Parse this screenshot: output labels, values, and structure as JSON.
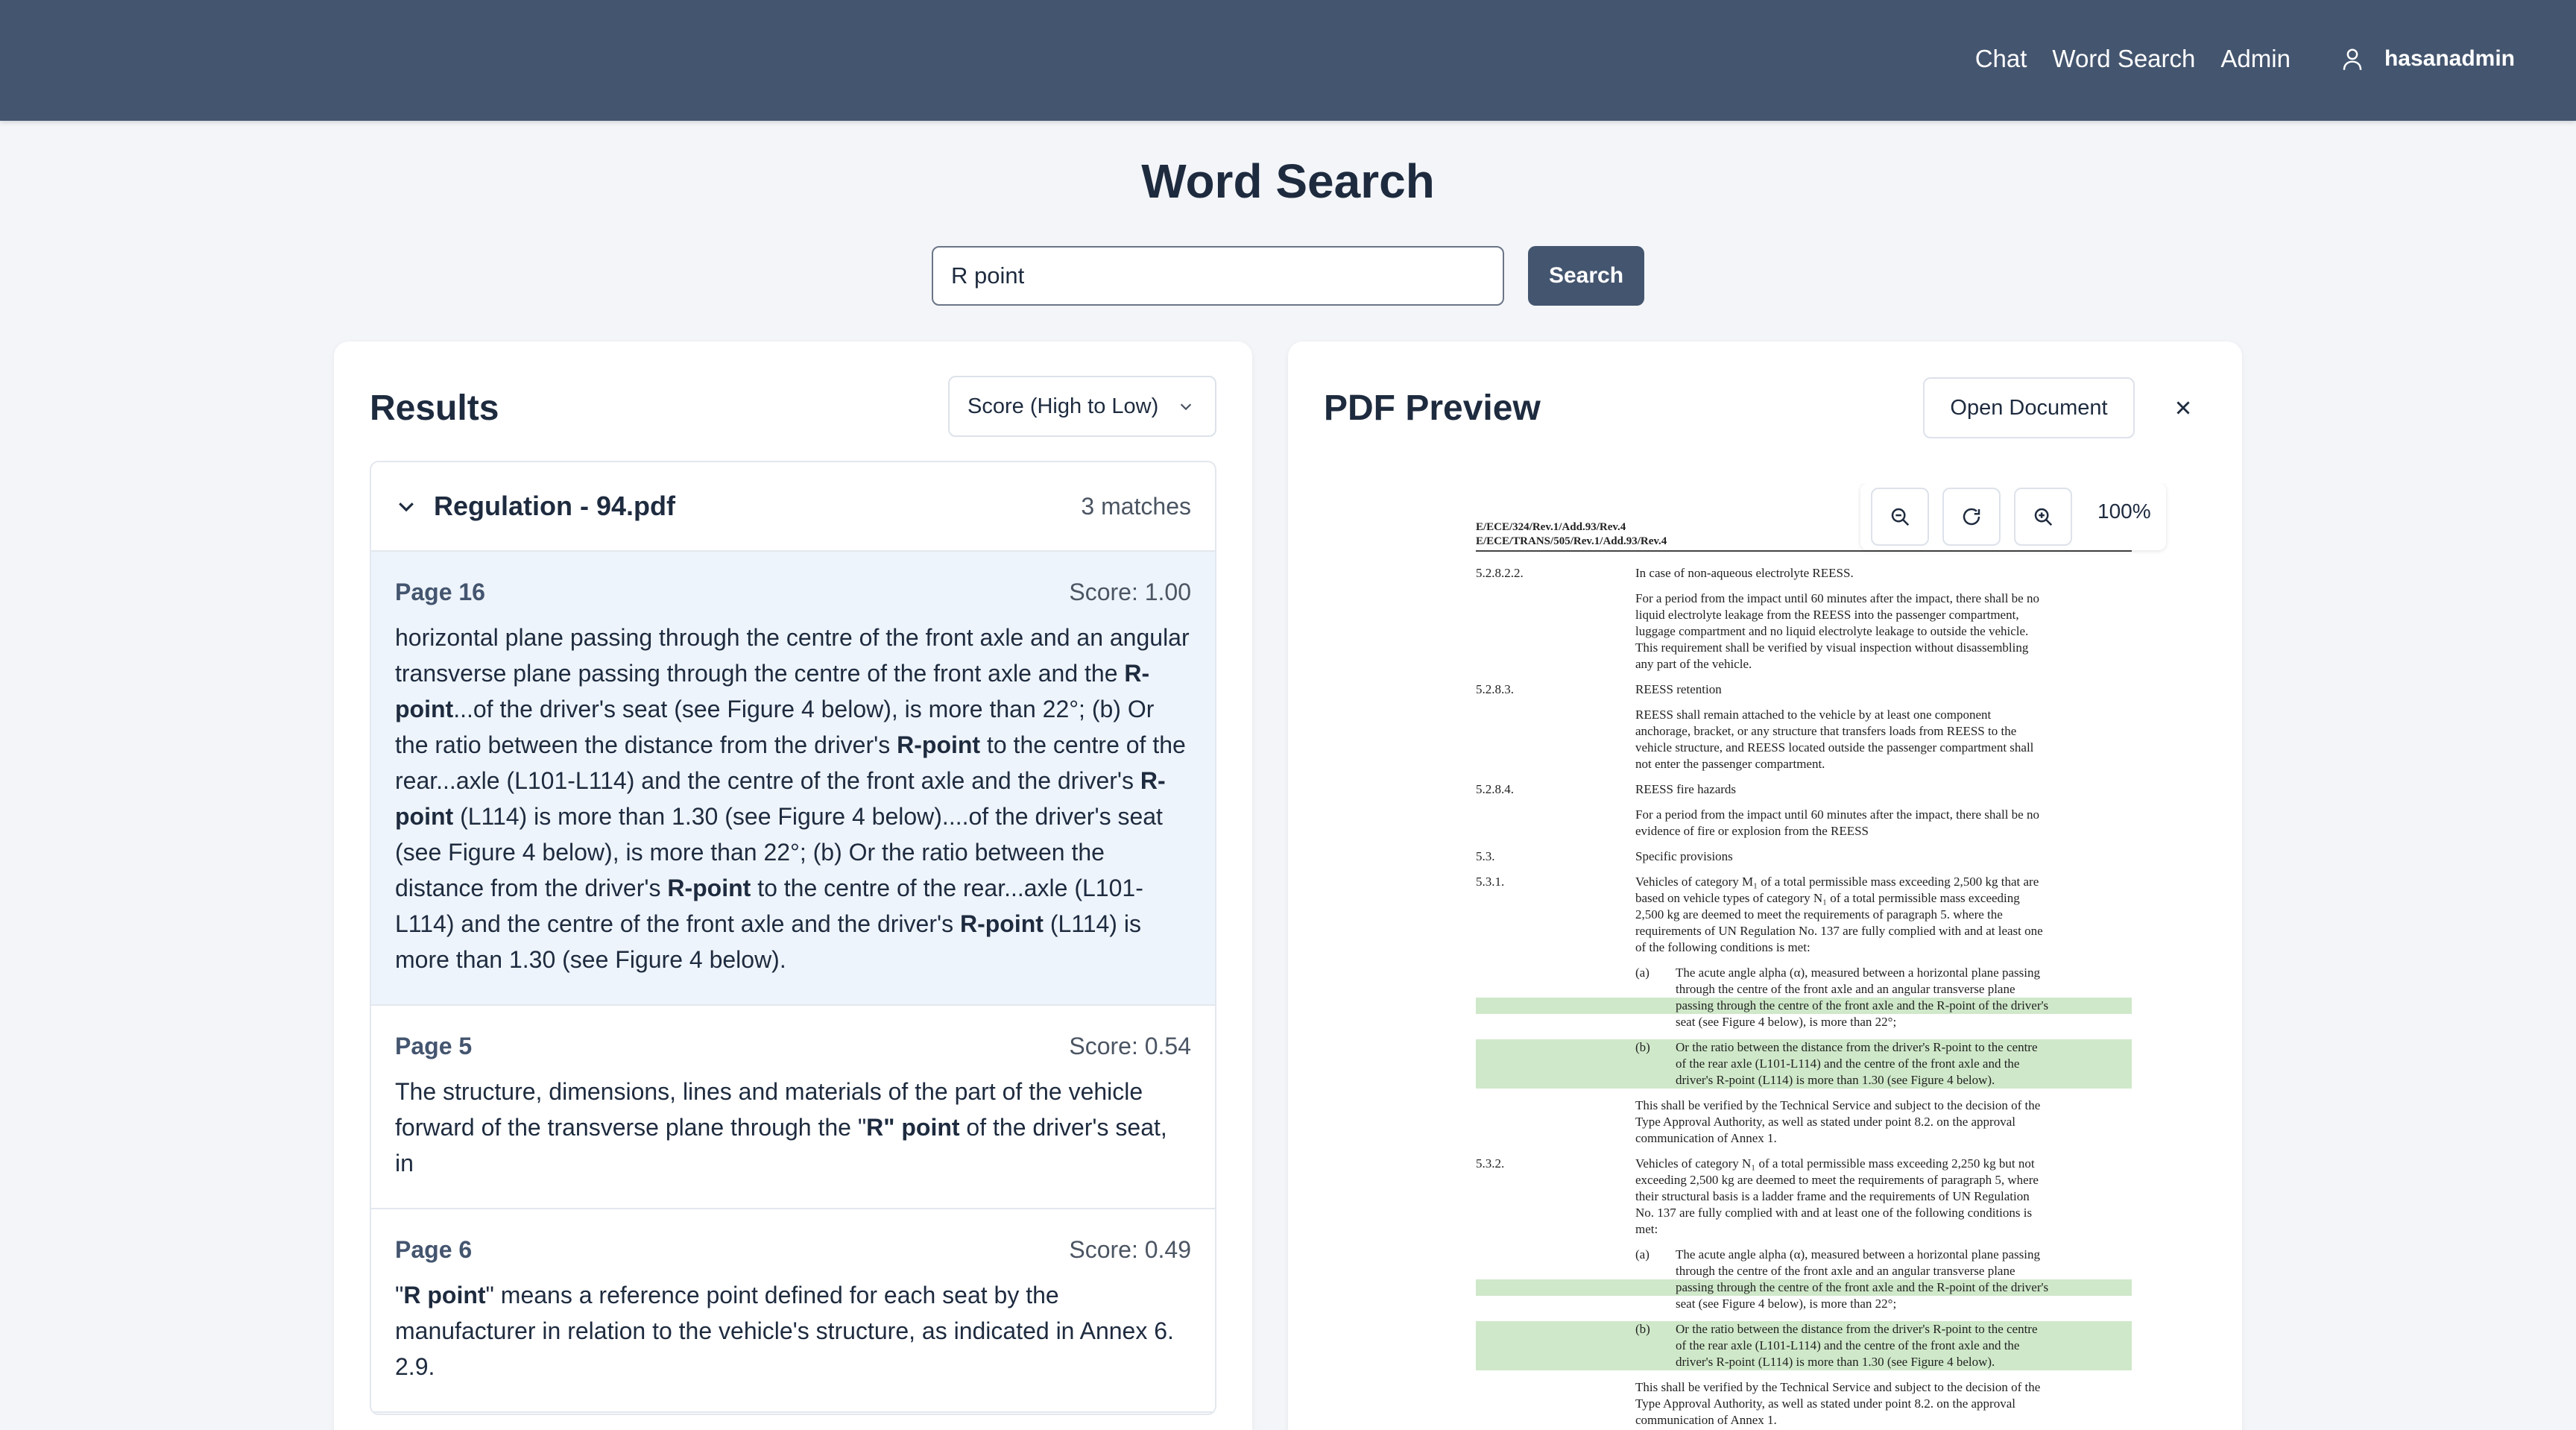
{
  "nav": {
    "links": [
      "Chat",
      "Word Search",
      "Admin"
    ],
    "username": "hasanadmin"
  },
  "page": {
    "title": "Word Search"
  },
  "search": {
    "value": "R point",
    "button": "Search"
  },
  "results": {
    "title": "Results",
    "sort": "Score (High to Low)",
    "group": {
      "name": "Regulation - 94.pdf",
      "count": "3 matches"
    },
    "hits": [
      {
        "page": "Page 16",
        "score": "Score: 1.00",
        "parts": [
          {
            "t": "horizontal plane passing through the centre of the front axle and an angular transverse plane passing through the centre of the front axle and the ",
            "b": false
          },
          {
            "t": "R-point",
            "b": true
          },
          {
            "t": "...of the driver's seat (see Figure 4 below), is more than 22°; (b) Or the ratio between the distance from the driver's ",
            "b": false
          },
          {
            "t": "R-point",
            "b": true
          },
          {
            "t": " to the centre of the rear...axle (L101-L114) and the centre of the front axle and the driver's ",
            "b": false
          },
          {
            "t": "R-point",
            "b": true
          },
          {
            "t": " (L114) is more than 1.30 (see Figure 4 below)....of the driver's seat (see Figure 4 below), is more than 22°; (b) Or the ratio between the distance from the driver's ",
            "b": false
          },
          {
            "t": "R-point",
            "b": true
          },
          {
            "t": " to the centre of the rear...axle (L101-L114) and the centre of the front axle and the driver's ",
            "b": false
          },
          {
            "t": "R-point",
            "b": true
          },
          {
            "t": " (L114) is more than 1.30 (see Figure 4 below).",
            "b": false
          }
        ]
      },
      {
        "page": "Page 5",
        "score": "Score: 0.54",
        "parts": [
          {
            "t": "The structure, dimensions, lines and materials of the part of the vehicle forward of the transverse plane through the \"",
            "b": false
          },
          {
            "t": "R\" point",
            "b": true
          },
          {
            "t": " of the driver's seat, in",
            "b": false
          }
        ]
      },
      {
        "page": "Page 6",
        "score": "Score: 0.49",
        "parts": [
          {
            "t": "\"",
            "b": false
          },
          {
            "t": "R point",
            "b": true
          },
          {
            "t": "\" means a reference point defined for each seat by the manufacturer in relation to the vehicle's structure, as indicated in Annex 6. 2.9.",
            "b": false
          }
        ]
      }
    ]
  },
  "preview": {
    "title": "PDF Preview",
    "open_button": "Open Document",
    "zoom": "100%",
    "doc_ref": [
      "E/ECE/324/Rev.1/Add.93/Rev.4",
      "E/ECE/TRANS/505/Rev.1/Add.93/Rev.4"
    ],
    "lines": [
      {
        "num": "5.2.8.2.2.",
        "text": "In case of non-aqueous electrolyte REESS.",
        "indent": "main"
      },
      {
        "text": "For a period from the impact until 60 minutes after the impact, there shall be no",
        "indent": "main",
        "gap": true
      },
      {
        "text": "liquid electrolyte leakage from the REESS into the passenger compartment,",
        "indent": "main"
      },
      {
        "text": "luggage compartment and no liquid electrolyte leakage to outside the vehicle.",
        "indent": "main"
      },
      {
        "text": "This requirement shall be verified by visual inspection without disassembling",
        "indent": "main"
      },
      {
        "text": "any part of the vehicle.",
        "indent": "main"
      },
      {
        "num": "5.2.8.3.",
        "text": "REESS retention",
        "indent": "main",
        "gap": true
      },
      {
        "text": "REESS shall remain attached to the vehicle by at least one component",
        "indent": "main",
        "gap": true
      },
      {
        "text": "anchorage, bracket, or any structure that transfers loads from REESS to the",
        "indent": "main"
      },
      {
        "text": "vehicle structure, and REESS located outside the passenger compartment shall",
        "indent": "main"
      },
      {
        "text": "not enter the passenger compartment.",
        "indent": "main"
      },
      {
        "num": "5.2.8.4.",
        "text": "REESS fire hazards",
        "indent": "main",
        "gap": true
      },
      {
        "text": "For a period from the impact until 60 minutes after the impact, there shall be no",
        "indent": "main",
        "gap": true
      },
      {
        "text": "evidence of fire or explosion from the REESS",
        "indent": "main"
      },
      {
        "num": "5.3.",
        "text": "Specific provisions",
        "indent": "main",
        "gap": true
      },
      {
        "num": "5.3.1.",
        "text": "Vehicles of category M₁ of a total permissible mass exceeding 2,500 kg that are",
        "indent": "main",
        "gap": true
      },
      {
        "text": "based on vehicle types of category N₁ of a total permissible mass exceeding",
        "indent": "main"
      },
      {
        "text": "2,500 kg are deemed to meet the requirements of paragraph 5. where the",
        "indent": "main"
      },
      {
        "text": "requirements of UN Regulation No. 137 are fully complied with and at least one",
        "indent": "main"
      },
      {
        "text": "of the following conditions is met:",
        "indent": "main"
      },
      {
        "num": "(a)",
        "text": "The acute angle alpha (α), measured between a horizontal plane passing",
        "indent": "sub",
        "gap": true
      },
      {
        "text": "through the centre of the front axle and an angular transverse plane",
        "indent": "sub"
      },
      {
        "text": "passing through the centre of the front axle and the R-point of the driver's",
        "indent": "sub",
        "hl": true
      },
      {
        "text": "seat (see Figure 4 below), is more than 22°;",
        "indent": "sub"
      },
      {
        "num": "(b)",
        "text": "Or the ratio between the distance from the driver's R-point to the centre",
        "indent": "sub",
        "gap": true,
        "hl": true
      },
      {
        "text": "of the rear axle (L101-L114) and the centre of the front axle and the",
        "indent": "sub",
        "hl": true
      },
      {
        "text": "driver's R-point (L114) is more than 1.30 (see Figure 4 below).",
        "indent": "sub",
        "hl": true
      },
      {
        "text": "This shall be verified by the Technical Service and subject to the decision of the",
        "indent": "main",
        "gap": true
      },
      {
        "text": "Type Approval Authority, as well as stated under point 8.2. on the approval",
        "indent": "main"
      },
      {
        "text": "communication of Annex 1.",
        "indent": "main"
      },
      {
        "num": "5.3.2.",
        "text": "Vehicles of category N₁ of a total permissible mass exceeding 2,250 kg but not",
        "indent": "main",
        "gap": true
      },
      {
        "text": "exceeding 2,500 kg are deemed to meet the requirements of paragraph 5, where",
        "indent": "main"
      },
      {
        "text": "their structural basis is a ladder frame and the requirements of UN Regulation",
        "indent": "main"
      },
      {
        "text": "No. 137 are fully complied with and at least one of the following conditions is",
        "indent": "main"
      },
      {
        "text": "met:",
        "indent": "main"
      },
      {
        "num": "(a)",
        "text": "The acute angle alpha (α), measured between a horizontal plane passing",
        "indent": "sub",
        "gap": true
      },
      {
        "text": "through the centre of the front axle and an angular transverse plane",
        "indent": "sub"
      },
      {
        "text": "passing through the centre of the front axle and the R-point of the driver's",
        "indent": "sub",
        "hl": true
      },
      {
        "text": "seat (see Figure 4 below), is more than 22°;",
        "indent": "sub"
      },
      {
        "num": "(b)",
        "text": "Or the ratio between the distance from the driver's R-point to the centre",
        "indent": "sub",
        "gap": true,
        "hl": true
      },
      {
        "text": "of the rear axle (L101-L114) and the centre of the front axle and the",
        "indent": "sub",
        "hl": true
      },
      {
        "text": "driver's R-point (L114) is more than 1.30 (see Figure 4 below).",
        "indent": "sub",
        "hl": true
      },
      {
        "text": "This shall be verified by the Technical Service and subject to the decision of the",
        "indent": "main",
        "gap": true
      },
      {
        "text": "Type Approval Authority, as well as stated under point 8.2. on the approval",
        "indent": "main"
      },
      {
        "text": "communication of Annex 1.",
        "indent": "main"
      }
    ]
  }
}
